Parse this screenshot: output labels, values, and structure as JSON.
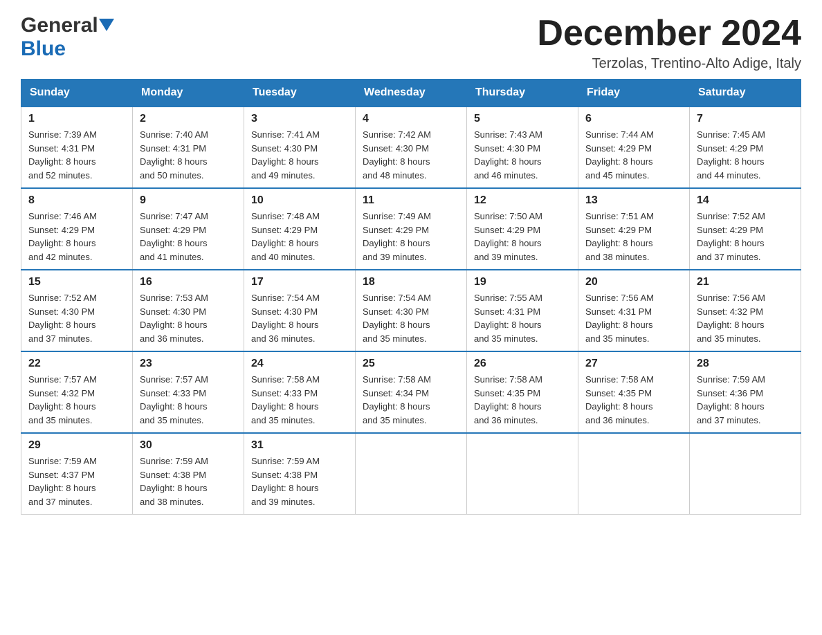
{
  "header": {
    "logo_general": "General",
    "logo_blue": "Blue",
    "month_title": "December 2024",
    "location": "Terzolas, Trentino-Alto Adige, Italy"
  },
  "days_of_week": [
    "Sunday",
    "Monday",
    "Tuesday",
    "Wednesday",
    "Thursday",
    "Friday",
    "Saturday"
  ],
  "weeks": [
    [
      {
        "day": "1",
        "sunrise": "7:39 AM",
        "sunset": "4:31 PM",
        "daylight": "8 hours and 52 minutes."
      },
      {
        "day": "2",
        "sunrise": "7:40 AM",
        "sunset": "4:31 PM",
        "daylight": "8 hours and 50 minutes."
      },
      {
        "day": "3",
        "sunrise": "7:41 AM",
        "sunset": "4:30 PM",
        "daylight": "8 hours and 49 minutes."
      },
      {
        "day": "4",
        "sunrise": "7:42 AM",
        "sunset": "4:30 PM",
        "daylight": "8 hours and 48 minutes."
      },
      {
        "day": "5",
        "sunrise": "7:43 AM",
        "sunset": "4:30 PM",
        "daylight": "8 hours and 46 minutes."
      },
      {
        "day": "6",
        "sunrise": "7:44 AM",
        "sunset": "4:29 PM",
        "daylight": "8 hours and 45 minutes."
      },
      {
        "day": "7",
        "sunrise": "7:45 AM",
        "sunset": "4:29 PM",
        "daylight": "8 hours and 44 minutes."
      }
    ],
    [
      {
        "day": "8",
        "sunrise": "7:46 AM",
        "sunset": "4:29 PM",
        "daylight": "8 hours and 42 minutes."
      },
      {
        "day": "9",
        "sunrise": "7:47 AM",
        "sunset": "4:29 PM",
        "daylight": "8 hours and 41 minutes."
      },
      {
        "day": "10",
        "sunrise": "7:48 AM",
        "sunset": "4:29 PM",
        "daylight": "8 hours and 40 minutes."
      },
      {
        "day": "11",
        "sunrise": "7:49 AM",
        "sunset": "4:29 PM",
        "daylight": "8 hours and 39 minutes."
      },
      {
        "day": "12",
        "sunrise": "7:50 AM",
        "sunset": "4:29 PM",
        "daylight": "8 hours and 39 minutes."
      },
      {
        "day": "13",
        "sunrise": "7:51 AM",
        "sunset": "4:29 PM",
        "daylight": "8 hours and 38 minutes."
      },
      {
        "day": "14",
        "sunrise": "7:52 AM",
        "sunset": "4:29 PM",
        "daylight": "8 hours and 37 minutes."
      }
    ],
    [
      {
        "day": "15",
        "sunrise": "7:52 AM",
        "sunset": "4:30 PM",
        "daylight": "8 hours and 37 minutes."
      },
      {
        "day": "16",
        "sunrise": "7:53 AM",
        "sunset": "4:30 PM",
        "daylight": "8 hours and 36 minutes."
      },
      {
        "day": "17",
        "sunrise": "7:54 AM",
        "sunset": "4:30 PM",
        "daylight": "8 hours and 36 minutes."
      },
      {
        "day": "18",
        "sunrise": "7:54 AM",
        "sunset": "4:30 PM",
        "daylight": "8 hours and 35 minutes."
      },
      {
        "day": "19",
        "sunrise": "7:55 AM",
        "sunset": "4:31 PM",
        "daylight": "8 hours and 35 minutes."
      },
      {
        "day": "20",
        "sunrise": "7:56 AM",
        "sunset": "4:31 PM",
        "daylight": "8 hours and 35 minutes."
      },
      {
        "day": "21",
        "sunrise": "7:56 AM",
        "sunset": "4:32 PM",
        "daylight": "8 hours and 35 minutes."
      }
    ],
    [
      {
        "day": "22",
        "sunrise": "7:57 AM",
        "sunset": "4:32 PM",
        "daylight": "8 hours and 35 minutes."
      },
      {
        "day": "23",
        "sunrise": "7:57 AM",
        "sunset": "4:33 PM",
        "daylight": "8 hours and 35 minutes."
      },
      {
        "day": "24",
        "sunrise": "7:58 AM",
        "sunset": "4:33 PM",
        "daylight": "8 hours and 35 minutes."
      },
      {
        "day": "25",
        "sunrise": "7:58 AM",
        "sunset": "4:34 PM",
        "daylight": "8 hours and 35 minutes."
      },
      {
        "day": "26",
        "sunrise": "7:58 AM",
        "sunset": "4:35 PM",
        "daylight": "8 hours and 36 minutes."
      },
      {
        "day": "27",
        "sunrise": "7:58 AM",
        "sunset": "4:35 PM",
        "daylight": "8 hours and 36 minutes."
      },
      {
        "day": "28",
        "sunrise": "7:59 AM",
        "sunset": "4:36 PM",
        "daylight": "8 hours and 37 minutes."
      }
    ],
    [
      {
        "day": "29",
        "sunrise": "7:59 AM",
        "sunset": "4:37 PM",
        "daylight": "8 hours and 37 minutes."
      },
      {
        "day": "30",
        "sunrise": "7:59 AM",
        "sunset": "4:38 PM",
        "daylight": "8 hours and 38 minutes."
      },
      {
        "day": "31",
        "sunrise": "7:59 AM",
        "sunset": "4:38 PM",
        "daylight": "8 hours and 39 minutes."
      },
      null,
      null,
      null,
      null
    ]
  ],
  "labels": {
    "sunrise": "Sunrise:",
    "sunset": "Sunset:",
    "daylight": "Daylight:"
  }
}
